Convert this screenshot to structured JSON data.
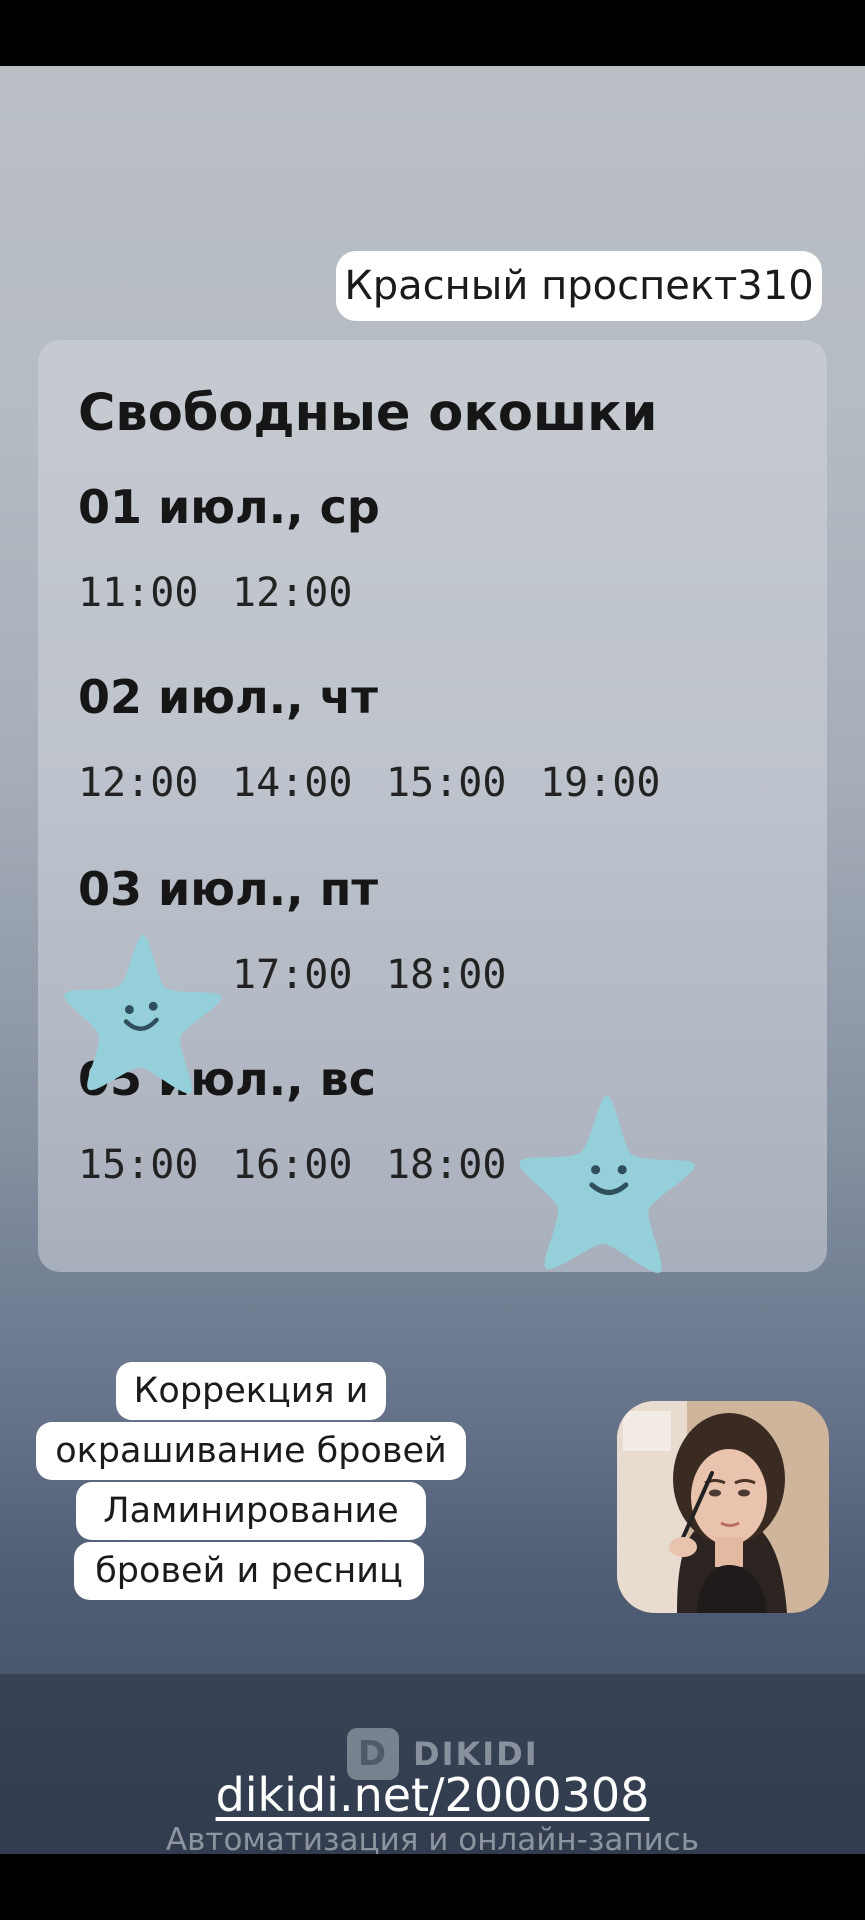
{
  "address": "Красный проспект310",
  "card": {
    "title": "Свободные окошки",
    "days": [
      {
        "date": "01 июл., ср",
        "times": [
          "11:00",
          "12:00"
        ]
      },
      {
        "date": "02 июл., чт",
        "times": [
          "12:00",
          "14:00",
          "15:00",
          "19:00"
        ]
      },
      {
        "date": "03 июл., пт",
        "times": [
          "17:00",
          "18:00"
        ]
      },
      {
        "date": "05 июл., вс",
        "times": [
          "15:00",
          "16:00",
          "18:00"
        ]
      }
    ]
  },
  "services": {
    "lines": [
      "Коррекция и",
      "окрашивание бровей",
      "Ламинирование",
      "бровей и ресниц"
    ]
  },
  "footer": {
    "brand": "DIKIDI",
    "brand_logo_letter": "D",
    "link": "dikidi.net/2000308",
    "tagline": "Автоматизация и онлайн-запись"
  },
  "colors": {
    "star": "#95cfd9",
    "star_face": "#2f4f5a"
  },
  "icons": [
    "star-sticker-icon",
    "dikidi-logo-icon"
  ]
}
